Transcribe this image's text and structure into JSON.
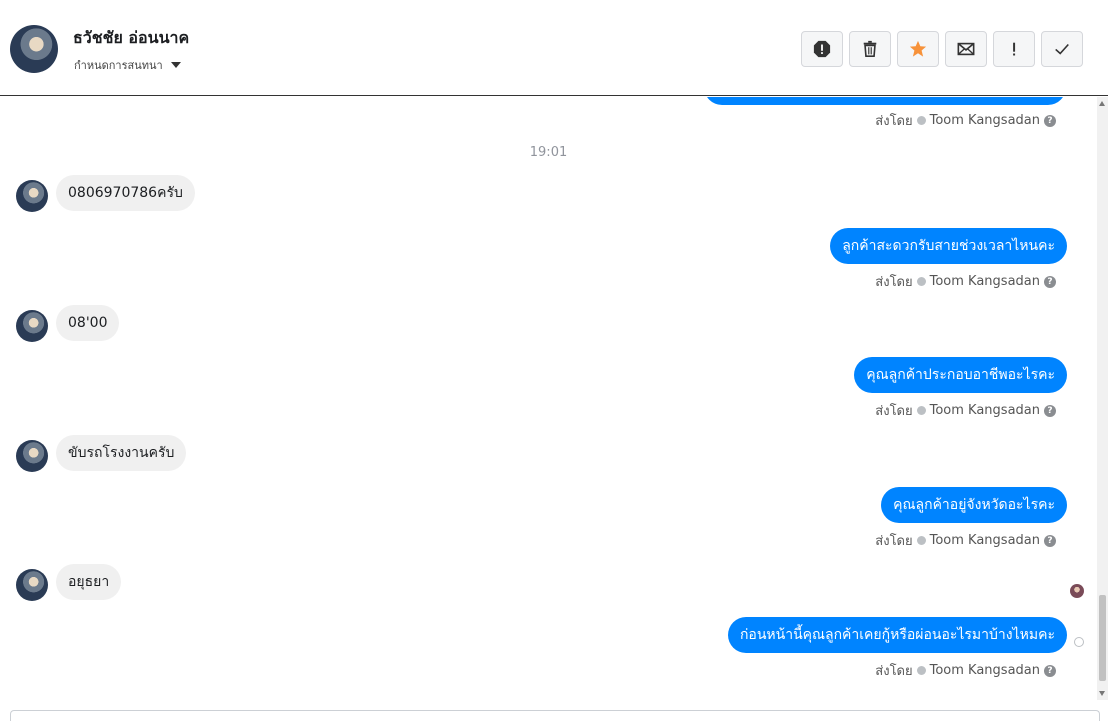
{
  "header": {
    "contact_name": "ธวัชชัย อ่อนนาค",
    "assign_label": "กำหนดการสนทนา",
    "toolbar": [
      {
        "icon": "spam-icon",
        "label": ""
      },
      {
        "icon": "trash-icon",
        "label": ""
      },
      {
        "icon": "star-icon",
        "label": "",
        "color": "#f7923a"
      },
      {
        "icon": "envelope-icon",
        "label": ""
      },
      {
        "icon": "exclamation-icon",
        "label": ""
      },
      {
        "icon": "checkmark-icon",
        "label": ""
      }
    ]
  },
  "conversation": {
    "time_divider": "19:01",
    "sent_by_label": "ส่งโดย",
    "sender_name": "Toom Kangsadan",
    "messages": [
      {
        "dir": "in",
        "text": "0806970786ครับ"
      },
      {
        "dir": "out",
        "text": "ลูกค้าสะดวกรับสายช่วงเวลาไหนคะ"
      },
      {
        "dir": "in",
        "text": "08'00"
      },
      {
        "dir": "out",
        "text": "คุณลูกค้าประกอบอาชีพอะไรคะ"
      },
      {
        "dir": "in",
        "text": "ขับรถโรงงานครับ"
      },
      {
        "dir": "out",
        "text": "คุณลูกค้าอยู่จังหวัดอะไรคะ"
      },
      {
        "dir": "in",
        "text": "อยุธยา"
      },
      {
        "dir": "out",
        "text": "ก่อนหน้านี้คุณลูกค้าเคยกู้หรือผ่อนอะไรมาบ้างไหมคะ"
      }
    ]
  },
  "colors": {
    "outgoing_bubble": "#0084ff",
    "incoming_bubble": "#f0f0f0",
    "star": "#f7923a"
  }
}
